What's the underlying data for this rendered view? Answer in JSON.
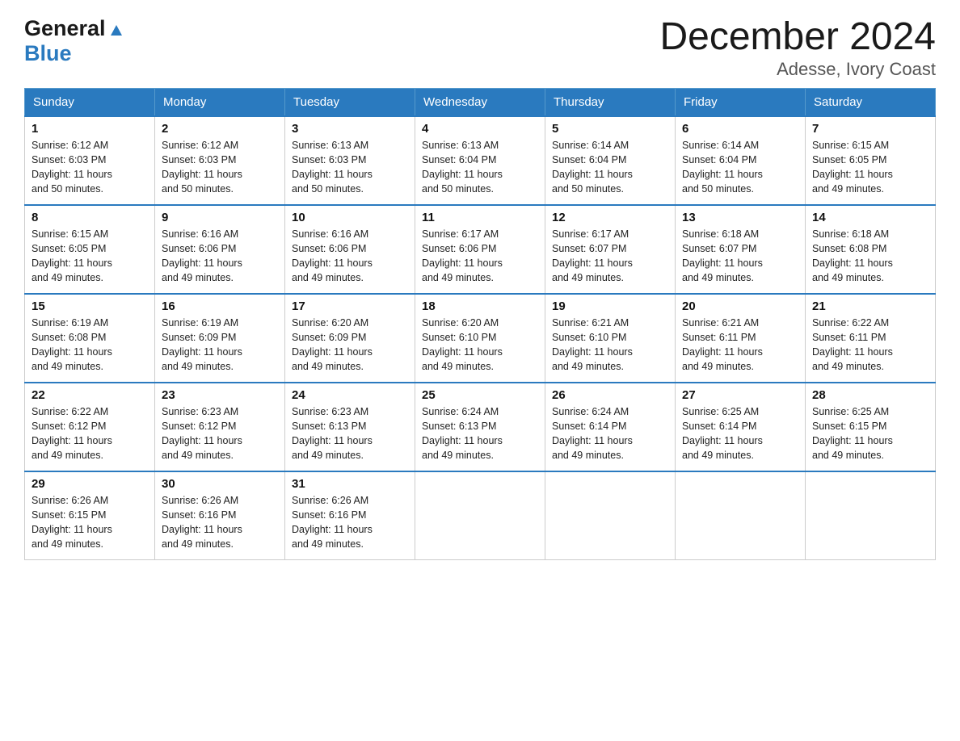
{
  "logo": {
    "general": "General",
    "blue": "Blue"
  },
  "title": {
    "month": "December 2024",
    "location": "Adesse, Ivory Coast"
  },
  "weekdays": [
    "Sunday",
    "Monday",
    "Tuesday",
    "Wednesday",
    "Thursday",
    "Friday",
    "Saturday"
  ],
  "weeks": [
    [
      {
        "day": "1",
        "sunrise": "6:12 AM",
        "sunset": "6:03 PM",
        "daylight": "11 hours and 50 minutes."
      },
      {
        "day": "2",
        "sunrise": "6:12 AM",
        "sunset": "6:03 PM",
        "daylight": "11 hours and 50 minutes."
      },
      {
        "day": "3",
        "sunrise": "6:13 AM",
        "sunset": "6:03 PM",
        "daylight": "11 hours and 50 minutes."
      },
      {
        "day": "4",
        "sunrise": "6:13 AM",
        "sunset": "6:04 PM",
        "daylight": "11 hours and 50 minutes."
      },
      {
        "day": "5",
        "sunrise": "6:14 AM",
        "sunset": "6:04 PM",
        "daylight": "11 hours and 50 minutes."
      },
      {
        "day": "6",
        "sunrise": "6:14 AM",
        "sunset": "6:04 PM",
        "daylight": "11 hours and 50 minutes."
      },
      {
        "day": "7",
        "sunrise": "6:15 AM",
        "sunset": "6:05 PM",
        "daylight": "11 hours and 49 minutes."
      }
    ],
    [
      {
        "day": "8",
        "sunrise": "6:15 AM",
        "sunset": "6:05 PM",
        "daylight": "11 hours and 49 minutes."
      },
      {
        "day": "9",
        "sunrise": "6:16 AM",
        "sunset": "6:06 PM",
        "daylight": "11 hours and 49 minutes."
      },
      {
        "day": "10",
        "sunrise": "6:16 AM",
        "sunset": "6:06 PM",
        "daylight": "11 hours and 49 minutes."
      },
      {
        "day": "11",
        "sunrise": "6:17 AM",
        "sunset": "6:06 PM",
        "daylight": "11 hours and 49 minutes."
      },
      {
        "day": "12",
        "sunrise": "6:17 AM",
        "sunset": "6:07 PM",
        "daylight": "11 hours and 49 minutes."
      },
      {
        "day": "13",
        "sunrise": "6:18 AM",
        "sunset": "6:07 PM",
        "daylight": "11 hours and 49 minutes."
      },
      {
        "day": "14",
        "sunrise": "6:18 AM",
        "sunset": "6:08 PM",
        "daylight": "11 hours and 49 minutes."
      }
    ],
    [
      {
        "day": "15",
        "sunrise": "6:19 AM",
        "sunset": "6:08 PM",
        "daylight": "11 hours and 49 minutes."
      },
      {
        "day": "16",
        "sunrise": "6:19 AM",
        "sunset": "6:09 PM",
        "daylight": "11 hours and 49 minutes."
      },
      {
        "day": "17",
        "sunrise": "6:20 AM",
        "sunset": "6:09 PM",
        "daylight": "11 hours and 49 minutes."
      },
      {
        "day": "18",
        "sunrise": "6:20 AM",
        "sunset": "6:10 PM",
        "daylight": "11 hours and 49 minutes."
      },
      {
        "day": "19",
        "sunrise": "6:21 AM",
        "sunset": "6:10 PM",
        "daylight": "11 hours and 49 minutes."
      },
      {
        "day": "20",
        "sunrise": "6:21 AM",
        "sunset": "6:11 PM",
        "daylight": "11 hours and 49 minutes."
      },
      {
        "day": "21",
        "sunrise": "6:22 AM",
        "sunset": "6:11 PM",
        "daylight": "11 hours and 49 minutes."
      }
    ],
    [
      {
        "day": "22",
        "sunrise": "6:22 AM",
        "sunset": "6:12 PM",
        "daylight": "11 hours and 49 minutes."
      },
      {
        "day": "23",
        "sunrise": "6:23 AM",
        "sunset": "6:12 PM",
        "daylight": "11 hours and 49 minutes."
      },
      {
        "day": "24",
        "sunrise": "6:23 AM",
        "sunset": "6:13 PM",
        "daylight": "11 hours and 49 minutes."
      },
      {
        "day": "25",
        "sunrise": "6:24 AM",
        "sunset": "6:13 PM",
        "daylight": "11 hours and 49 minutes."
      },
      {
        "day": "26",
        "sunrise": "6:24 AM",
        "sunset": "6:14 PM",
        "daylight": "11 hours and 49 minutes."
      },
      {
        "day": "27",
        "sunrise": "6:25 AM",
        "sunset": "6:14 PM",
        "daylight": "11 hours and 49 minutes."
      },
      {
        "day": "28",
        "sunrise": "6:25 AM",
        "sunset": "6:15 PM",
        "daylight": "11 hours and 49 minutes."
      }
    ],
    [
      {
        "day": "29",
        "sunrise": "6:26 AM",
        "sunset": "6:15 PM",
        "daylight": "11 hours and 49 minutes."
      },
      {
        "day": "30",
        "sunrise": "6:26 AM",
        "sunset": "6:16 PM",
        "daylight": "11 hours and 49 minutes."
      },
      {
        "day": "31",
        "sunrise": "6:26 AM",
        "sunset": "6:16 PM",
        "daylight": "11 hours and 49 minutes."
      },
      null,
      null,
      null,
      null
    ]
  ],
  "labels": {
    "sunrise": "Sunrise:",
    "sunset": "Sunset:",
    "daylight": "Daylight:"
  }
}
